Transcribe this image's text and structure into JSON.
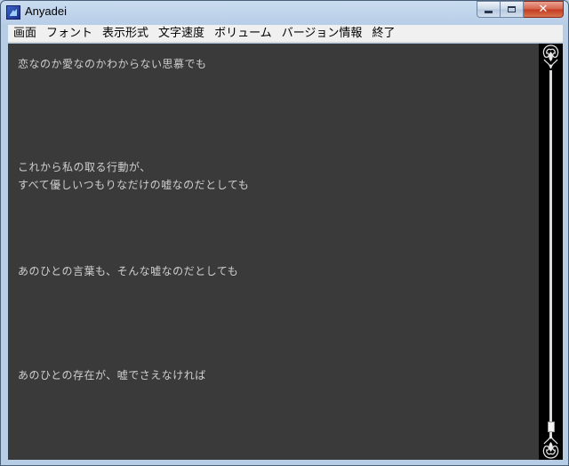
{
  "window": {
    "title": "Anyadei",
    "icon": "app-icon",
    "buttons": {
      "minimize": "minimize-icon",
      "maximize": "maximize-icon",
      "close": "✕"
    }
  },
  "menu": {
    "items": [
      "画面",
      "フォント",
      "表示形式",
      "文字速度",
      "ボリューム",
      "バージョン情報",
      "終了"
    ]
  },
  "content": {
    "lines": [
      "恋なのか愛なのかわからない思慕でも",
      "これから私の取る行動が、",
      "すべて優しいつもりなだけの嘘なのだとしても",
      "あのひとの言葉も、そんな嘘なのだとしても",
      "あのひとの存在が、嘘でさえなければ"
    ]
  },
  "colors": {
    "content_bg": "#3a3a3a",
    "text": "#cfcfcf",
    "scrollbar_bg": "#000000"
  }
}
